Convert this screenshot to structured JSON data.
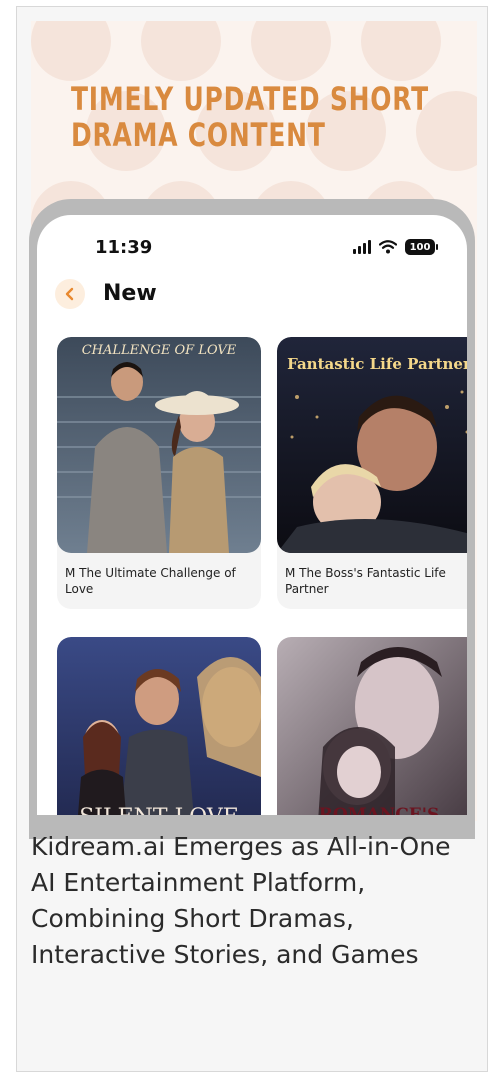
{
  "promo": {
    "title_line1": "TIMELY UPDATED SHORT",
    "title_line2": "DRAMA CONTENT",
    "title_color": "#d98a3f"
  },
  "status_bar": {
    "time": "11:39",
    "battery": "100"
  },
  "nav": {
    "back_icon": "chevron-left-icon",
    "title": "New"
  },
  "items": [
    {
      "poster_title": "CHALLENGE OF LOVE",
      "label": "M The Ultimate Challenge of Love"
    },
    {
      "poster_title": "Fantastic Life Partner",
      "label": "M  The Boss's Fantastic Life Partner"
    },
    {
      "poster_title": "SILENT LOVE",
      "label": ""
    },
    {
      "poster_title": "ROMANCE'S",
      "label": ""
    }
  ],
  "caption": "Kidream.ai Emerges as All-in-One AI Entertainment Platform, Combining Short Dramas, Interactive Stories, and Games"
}
